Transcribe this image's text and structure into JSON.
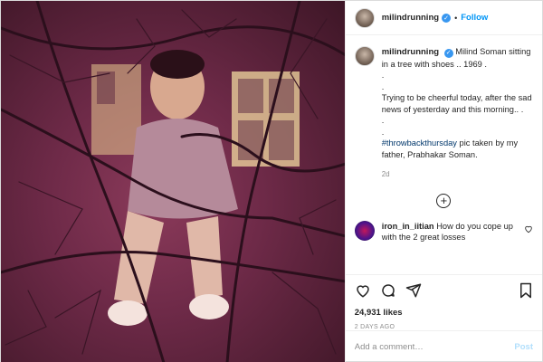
{
  "header": {
    "username": "milindrunning",
    "separator": "•",
    "follow_label": "Follow"
  },
  "caption": {
    "username": "milindrunning",
    "lines": [
      "Milind Soman sitting in a tree with shoes .. 1969 .",
      ".",
      ".",
      "Trying to be cheerful today, after the sad news of yesterday and this morning.. .",
      ".",
      "."
    ],
    "hashtag": "#throwbackthursday",
    "after_hashtag": " pic taken by my father, Prabhakar Soman.",
    "age": "2d"
  },
  "comment": {
    "username": "iron_in_iitian",
    "text": "How do you cope up with the 2 great losses"
  },
  "stats": {
    "likes": "24,931 likes",
    "date": "2 DAYS AGO"
  },
  "add_comment": {
    "placeholder": "Add a comment…",
    "post_label": "Post"
  },
  "icons": {
    "verified": "verified-badge-icon",
    "load_more": "plus-circle-icon",
    "like": "heart-icon",
    "comment": "comment-bubble-icon",
    "share": "paper-plane-icon",
    "save": "bookmark-icon"
  },
  "colors": {
    "accent": "#0095f6",
    "verified": "#3897f0",
    "hashtag": "#00376b",
    "muted": "#8e8e8e",
    "post_disabled": "#b2dffc"
  }
}
